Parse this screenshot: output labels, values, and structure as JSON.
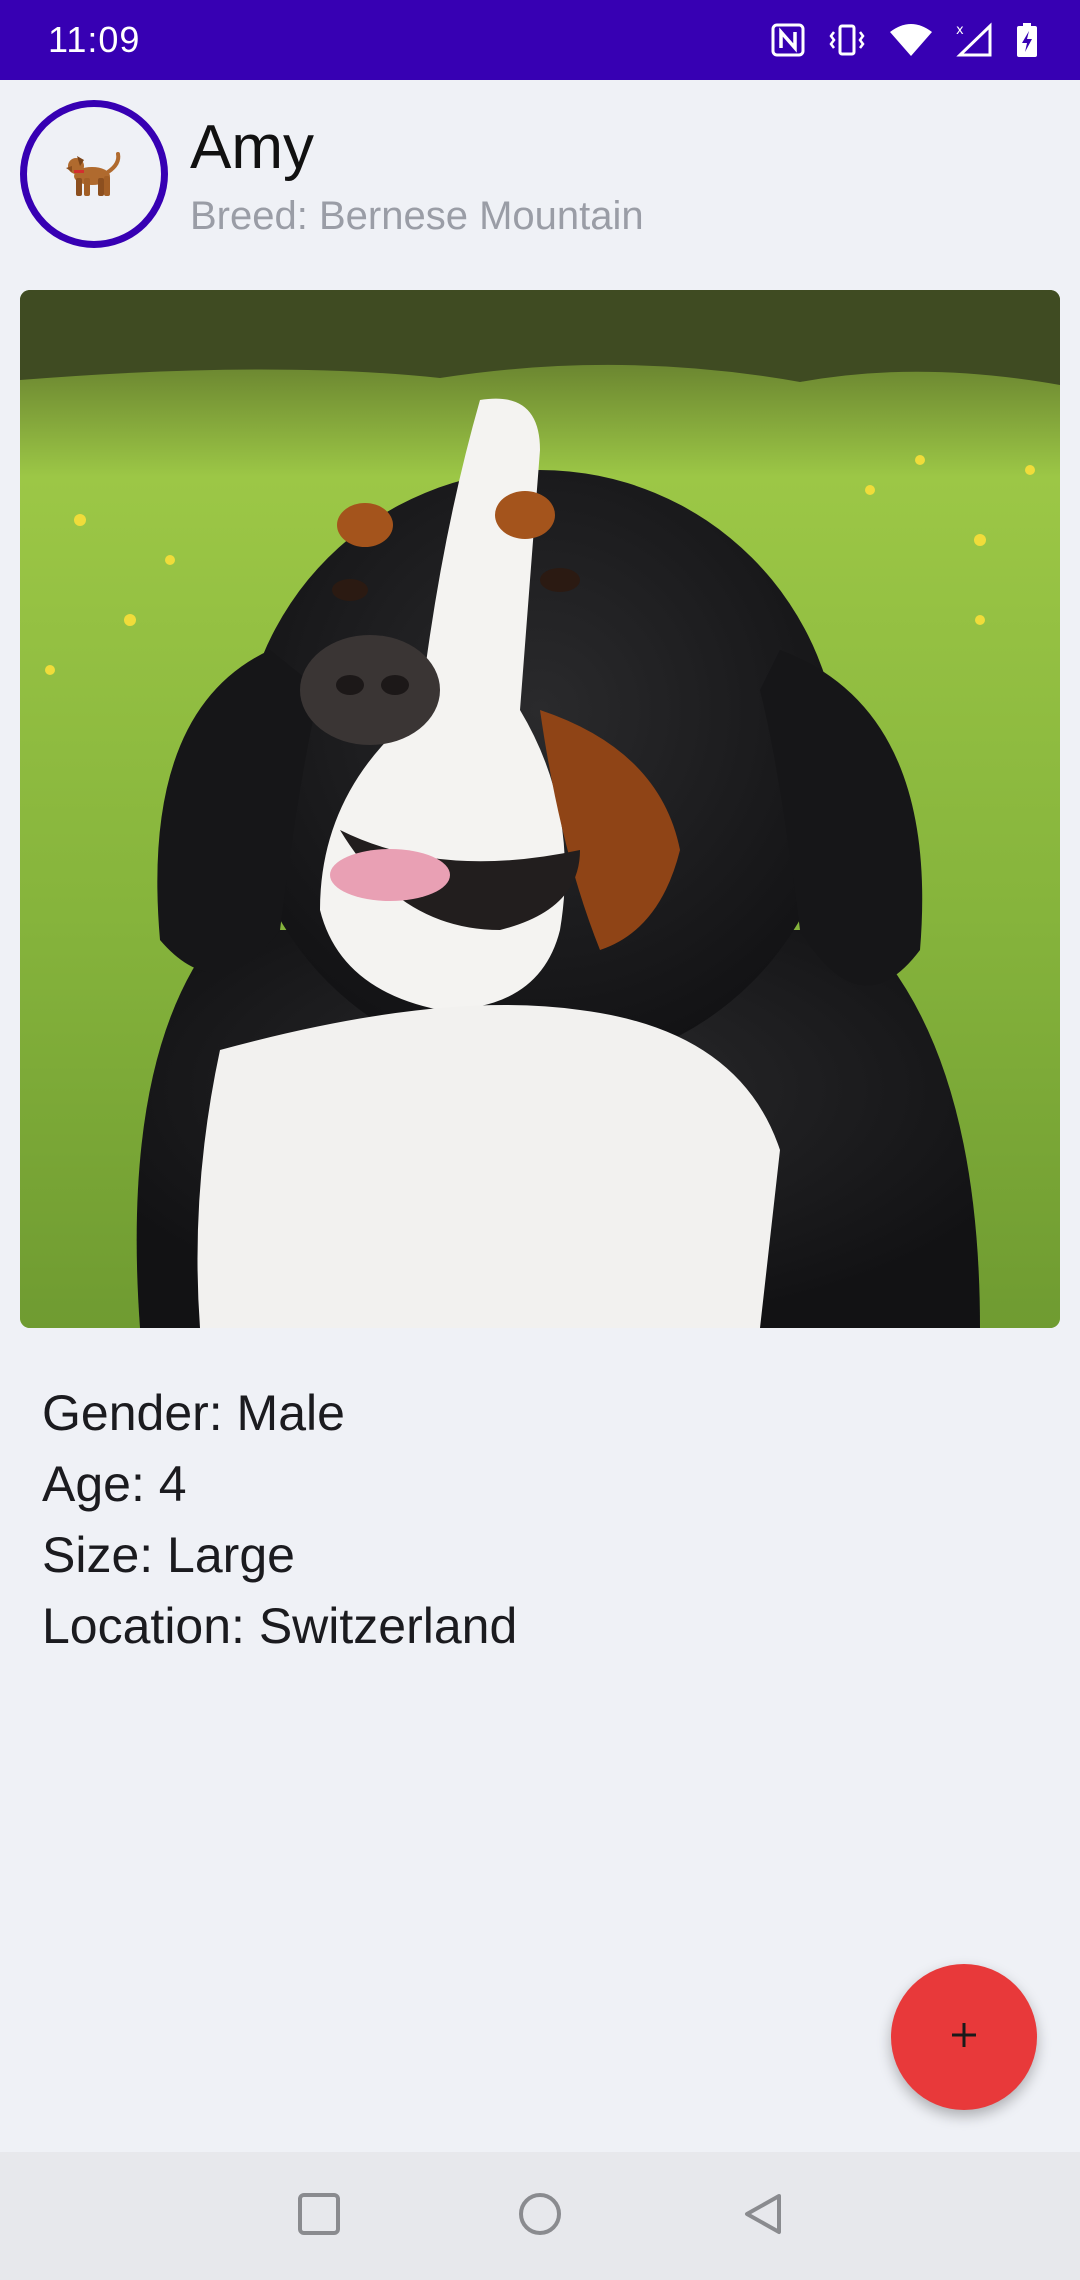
{
  "status_bar": {
    "time": "11:09",
    "icons": [
      "nfc-icon",
      "vibrate-icon",
      "wifi-icon",
      "signal-icon",
      "battery-charging-icon"
    ]
  },
  "header": {
    "avatar_icon": "dog-icon",
    "name": "Amy",
    "breed": "Breed: Bernese Mountain"
  },
  "photo": {
    "subject": "dog-photo"
  },
  "details": {
    "gender": "Gender: Male",
    "age": "Age: 4",
    "size": "Size: Large",
    "location": "Location: Switzerland"
  },
  "fab": {
    "label": "+",
    "icon": "plus-icon",
    "color": "#e8393a"
  },
  "nav_bar": {
    "icons": [
      "recents-icon",
      "home-icon",
      "back-icon"
    ]
  },
  "colors": {
    "primary_dark": "#3700b3",
    "background": "#eff1f6",
    "breed_text": "#9a9da6",
    "fab": "#e8393a"
  }
}
